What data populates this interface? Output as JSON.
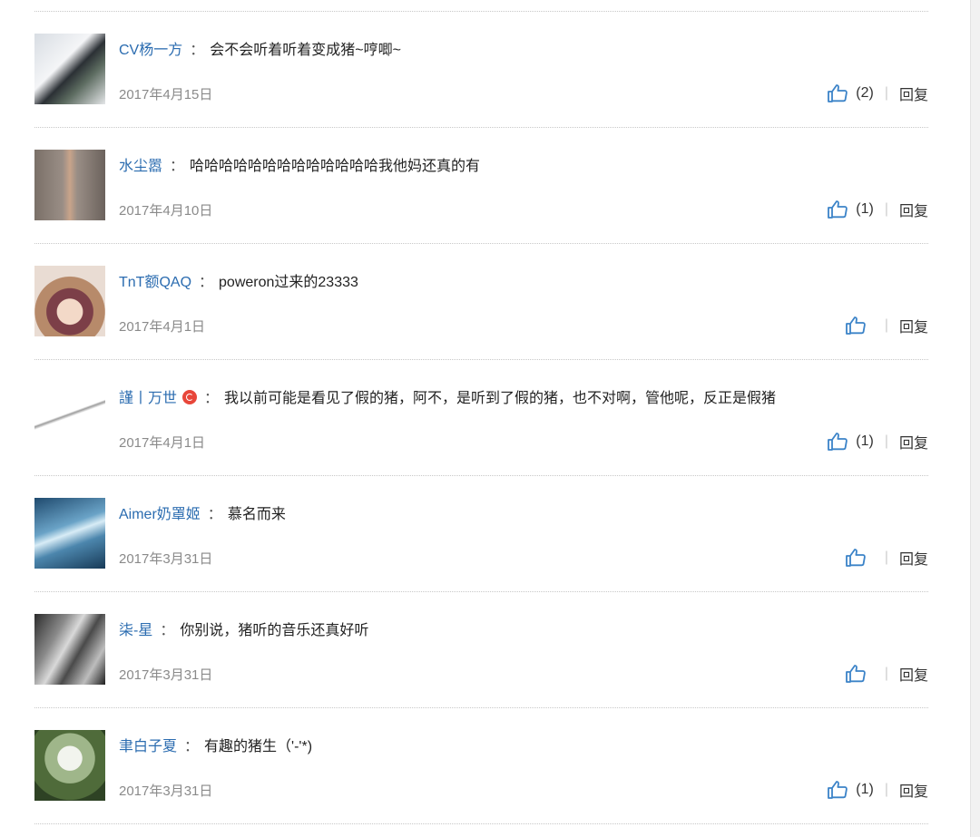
{
  "comments": [
    {
      "user": "CV杨一方",
      "text": "会不会听着听着变成猪~哼唧~",
      "date": "2017年4月15日",
      "likes": "(2)",
      "reply": "回复",
      "badge": false,
      "avatar": "linear-gradient(135deg,#d8dde3 0%,#f4f5f7 40%,#2b3035 55%,#5c6b60 70%,#e4e6e8 100%)"
    },
    {
      "user": "水尘嚣",
      "text": "哈哈哈哈哈哈哈哈哈哈哈哈哈我他妈还真的有",
      "date": "2017年4月10日",
      "likes": "(1)",
      "reply": "回复",
      "badge": false,
      "avatar": "linear-gradient(90deg,#7a7068 0%,#9a8e86 40%,#c9a48a 50%,#9a8e86 60%,#6b625c 100%)"
    },
    {
      "user": "TnT额QAQ",
      "text": "poweron过来的23333",
      "date": "2017年4月1日",
      "likes": "",
      "reply": "回复",
      "badge": false,
      "avatar": "radial-gradient(circle at 50% 65%,#f3d9c8 0 22%,#7c3f48 23% 40%,#b78a6a 41% 60%,#e9dcd3 61%)"
    },
    {
      "user": "謹丨万世",
      "text": "我以前可能是看见了假的猪，阿不，是听到了假的猪，也不对啊，管他呢，反正是假猪",
      "date": "2017年4月1日",
      "likes": "(1)",
      "reply": "回复",
      "badge": true,
      "avatar": "linear-gradient(160deg,#ffffff 0%,#ffffff 45%,#9c9c9c 47%,#ffffff 50%,#ffffff 100%)"
    },
    {
      "user": "Aimer奶罩姬",
      "text": "慕名而来",
      "date": "2017年3月31日",
      "likes": "",
      "reply": "回复",
      "badge": false,
      "avatar": "linear-gradient(160deg,#1f4a6e 0%,#6aa3c7 40%,#d8ecf6 50%,#4c86ad 65%,#173a57 100%)"
    },
    {
      "user": "柒-星",
      "text": "你别说，猪听的音乐还真好听",
      "date": "2017年3月31日",
      "likes": "",
      "reply": "回复",
      "badge": false,
      "avatar": "linear-gradient(120deg,#2c2c2c 0%,#8a8a8a 30%,#d9d9d9 45%,#4a4a4a 60%,#bdbdbd 80%,#1e1e1e 100%)"
    },
    {
      "user": "聿白子夏",
      "text": "有趣的猪生（'-'*)",
      "date": "2017年3月31日",
      "likes": "(1)",
      "reply": "回复",
      "badge": false,
      "avatar": "radial-gradient(circle at 50% 40%,#f2f4ee 0 22%,#9fb68a 23% 45%,#4f6b3a 46% 75%,#2e4224 76%)"
    }
  ],
  "colors": {
    "link": "#2b6cb0",
    "date": "#8a8a8a",
    "like_icon": "#3b83c8"
  },
  "icons": {
    "like": "thumbs-up-icon"
  }
}
